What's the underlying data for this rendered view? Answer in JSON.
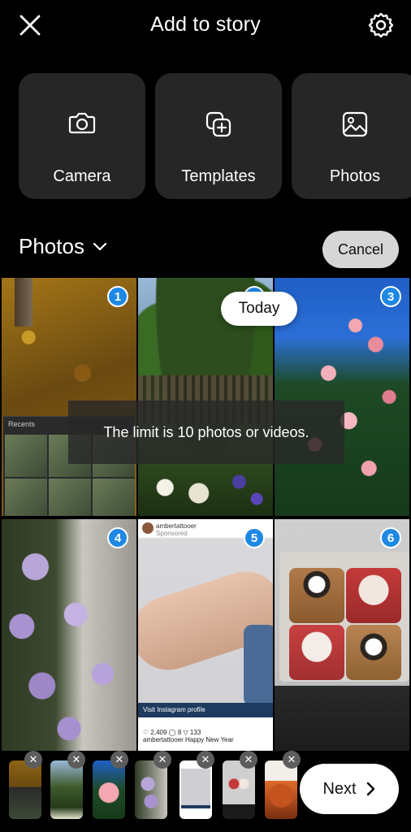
{
  "header": {
    "title": "Add to story",
    "close_icon": "close-icon",
    "settings_icon": "gear-icon"
  },
  "tiles": [
    {
      "label": "Camera",
      "icon": "camera-icon"
    },
    {
      "label": "Templates",
      "icon": "templates-icon"
    },
    {
      "label": "Photos",
      "icon": "image-icon"
    }
  ],
  "album": {
    "title": "Photos",
    "cancel_label": "Cancel"
  },
  "grid": {
    "badges": [
      "1",
      "",
      "3",
      "4",
      "5",
      "6"
    ],
    "mini_label": "Recents",
    "instagram_handle": "ambertattooer",
    "instagram_sponsored": "Sponsored",
    "visit_profile": "Visit Instagram profile",
    "likes": "2,409",
    "comments": "8",
    "shares": "133",
    "caption": "ambertattooer Happy New Year"
  },
  "overlay": {
    "today": "Today",
    "limit_message": "The limit is 10 photos or videos."
  },
  "tray": {
    "remove_glyph": "✕",
    "next_label": "Next",
    "next_icon": "chevron-right-icon"
  },
  "colors": {
    "background": "#000000",
    "tile": "#262626",
    "badge": "#1e88e5",
    "cancel": "#d6d6d6"
  }
}
